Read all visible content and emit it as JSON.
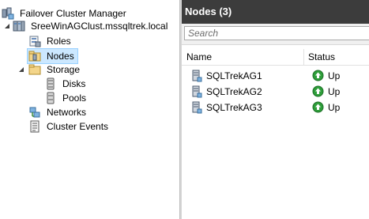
{
  "tree": {
    "root": {
      "label": "Failover Cluster Manager",
      "icon": "failover-cluster-manager-icon"
    },
    "cluster": {
      "label": "SreeWinAGClust.mssqltrek.local",
      "icon": "cluster-icon"
    },
    "items": [
      {
        "label": "Roles",
        "icon": "roles-icon"
      },
      {
        "label": "Nodes",
        "icon": "nodes-icon",
        "selected": true
      },
      {
        "label": "Storage",
        "icon": "storage-folder-icon"
      },
      {
        "label": "Disks",
        "icon": "disks-icon"
      },
      {
        "label": "Pools",
        "icon": "pools-icon"
      },
      {
        "label": "Networks",
        "icon": "networks-icon"
      },
      {
        "label": "Cluster Events",
        "icon": "cluster-events-icon"
      }
    ]
  },
  "pane": {
    "title": "Nodes (3)",
    "search_placeholder": "Search",
    "columns": {
      "name": "Name",
      "status": "Status"
    },
    "rows": [
      {
        "name": "SQLTrekAG1",
        "status": "Up"
      },
      {
        "name": "SQLTrekAG2",
        "status": "Up"
      },
      {
        "name": "SQLTrekAG3",
        "status": "Up"
      }
    ]
  },
  "colors": {
    "header_bg": "#3c3c3c",
    "selection_bg": "#cce8ff",
    "status_up": "#2e9e3a"
  }
}
